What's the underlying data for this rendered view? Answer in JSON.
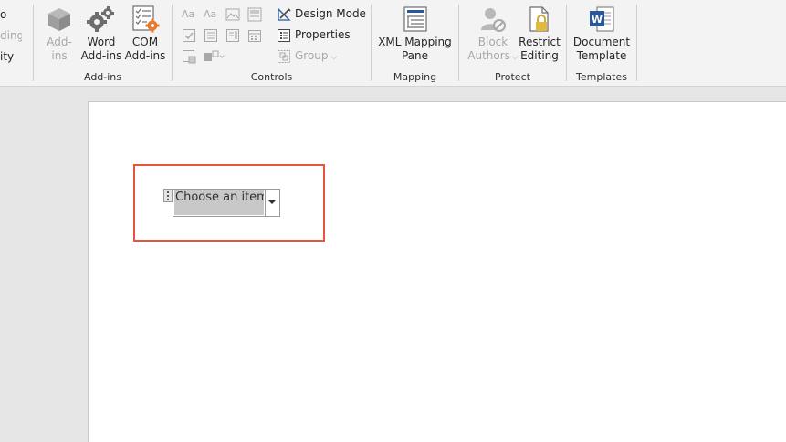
{
  "ribbon": {
    "left_partial": [
      "o",
      "ding",
      "ity"
    ],
    "addins": {
      "label": "Add-ins",
      "addins_line1": "Add-",
      "addins_line2": "ins",
      "word_line1": "Word",
      "word_line2": "Add-ins",
      "com_line1": "COM",
      "com_line2": "Add-ins"
    },
    "controls": {
      "label": "Controls",
      "design_mode": "Design Mode",
      "properties": "Properties",
      "group": "Group"
    },
    "mapping": {
      "label": "Mapping",
      "xml_line1": "XML Mapping",
      "xml_line2": "Pane"
    },
    "protect": {
      "label": "Protect",
      "block_line1": "Block",
      "block_line2": "Authors",
      "restrict_line1": "Restrict",
      "restrict_line2": "Editing"
    },
    "templates": {
      "label": "Templates",
      "doc_line1": "Document",
      "doc_line2": "Template"
    }
  },
  "document": {
    "content_control_text": "Choose an item."
  },
  "colors": {
    "highlight": "#e8553f",
    "word_blue": "#2b579a",
    "gear_orange": "#e8792b"
  }
}
